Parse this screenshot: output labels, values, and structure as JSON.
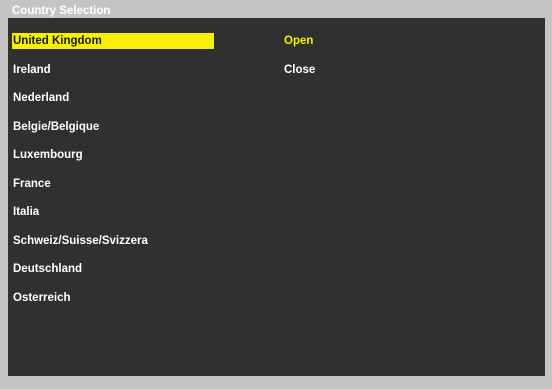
{
  "window": {
    "title": "Country Selection"
  },
  "countries": {
    "items": [
      {
        "label": "United Kingdom",
        "selected": true
      },
      {
        "label": "Ireland",
        "selected": false
      },
      {
        "label": "Nederland",
        "selected": false
      },
      {
        "label": "Belgie/Belgique",
        "selected": false
      },
      {
        "label": "Luxembourg",
        "selected": false
      },
      {
        "label": "France",
        "selected": false
      },
      {
        "label": "Italia",
        "selected": false
      },
      {
        "label": "Schweiz/Suisse/Svizzera",
        "selected": false
      },
      {
        "label": "Deutschland",
        "selected": false
      },
      {
        "label": "Osterreich",
        "selected": false
      }
    ]
  },
  "actions": {
    "open_label": "Open",
    "close_label": "Close"
  },
  "colors": {
    "frame": "#c4c4c4",
    "panel": "#303030",
    "highlight": "#f7f000",
    "text": "#ffffff"
  }
}
